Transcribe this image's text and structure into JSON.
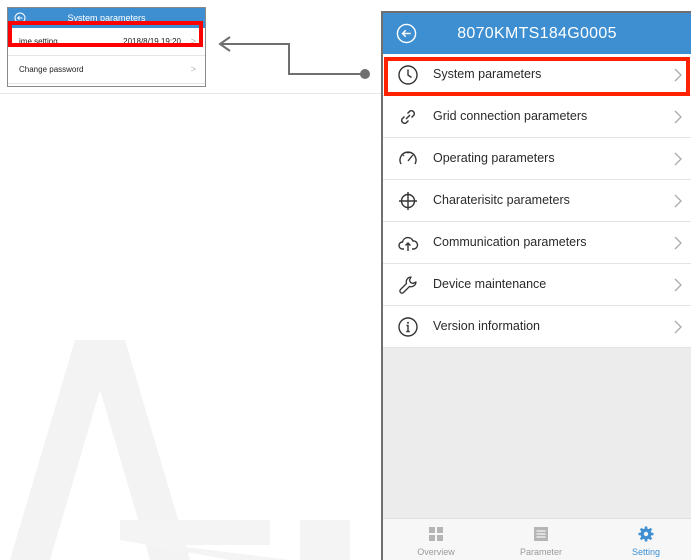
{
  "colors": {
    "header_blue": "#3d8fd1",
    "highlight_red": "#ff0000",
    "active_tab": "#3d8fd1"
  },
  "inset": {
    "title": "System parameters",
    "rows": [
      {
        "label": "ime setting",
        "value": "2018/8/19 19:20"
      },
      {
        "label": "Change password",
        "value": ""
      }
    ]
  },
  "phone": {
    "title": "8070KMTS184G0005",
    "menu": [
      {
        "label": "System parameters",
        "icon": "clock-icon"
      },
      {
        "label": "Grid connection parameters",
        "icon": "link-icon"
      },
      {
        "label": "Operating parameters",
        "icon": "gauge-icon"
      },
      {
        "label": "Charaterisitc parameters",
        "icon": "crosshair-icon"
      },
      {
        "label": "Communication parameters",
        "icon": "cloud-upload-icon"
      },
      {
        "label": "Device maintenance",
        "icon": "wrench-icon"
      },
      {
        "label": "Version information",
        "icon": "info-icon"
      }
    ],
    "tabs": [
      {
        "label": "Overview",
        "icon": "grid-icon"
      },
      {
        "label": "Parameter",
        "icon": "list-icon"
      },
      {
        "label": "Setting",
        "icon": "gear-icon"
      }
    ]
  }
}
